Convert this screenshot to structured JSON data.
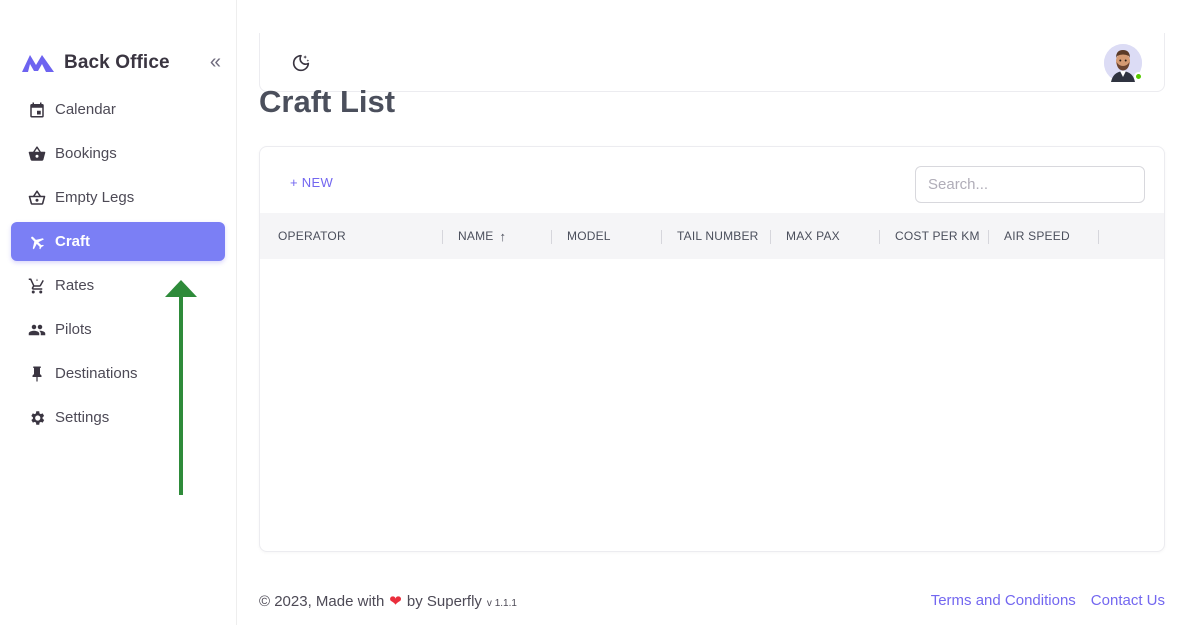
{
  "brand": {
    "title": "Back Office",
    "collapse_icon": "«"
  },
  "nav": {
    "items": [
      {
        "label": "Calendar",
        "icon": "calendar-icon"
      },
      {
        "label": "Bookings",
        "icon": "basket-icon"
      },
      {
        "label": "Empty Legs",
        "icon": "basket-outline-icon"
      },
      {
        "label": "Craft",
        "icon": "airplane-icon",
        "active": true
      },
      {
        "label": "Rates",
        "icon": "cart-outline-icon"
      },
      {
        "label": "Pilots",
        "icon": "people-icon"
      },
      {
        "label": "Destinations",
        "icon": "pin-icon"
      },
      {
        "label": "Settings",
        "icon": "gear-icon"
      }
    ]
  },
  "page": {
    "title": "Craft List"
  },
  "toolbar": {
    "new_label": "+ NEW",
    "search_placeholder": "Search..."
  },
  "table": {
    "columns": [
      "OPERATOR",
      "NAME",
      "MODEL",
      "TAIL NUMBER",
      "MAX PAX",
      "COST PER KM",
      "AIR SPEED"
    ],
    "sort_indicator": "↑"
  },
  "footer": {
    "copyright": "© 2023, Made with",
    "by": "by Superfly",
    "version": "v 1.1.1",
    "terms": "Terms and Conditions",
    "contact": "Contact Us"
  },
  "colors": {
    "accent": "#7367f0",
    "active_bg": "#7b7ff5",
    "arrow": "#2e8b3a",
    "online": "#56ca00"
  }
}
